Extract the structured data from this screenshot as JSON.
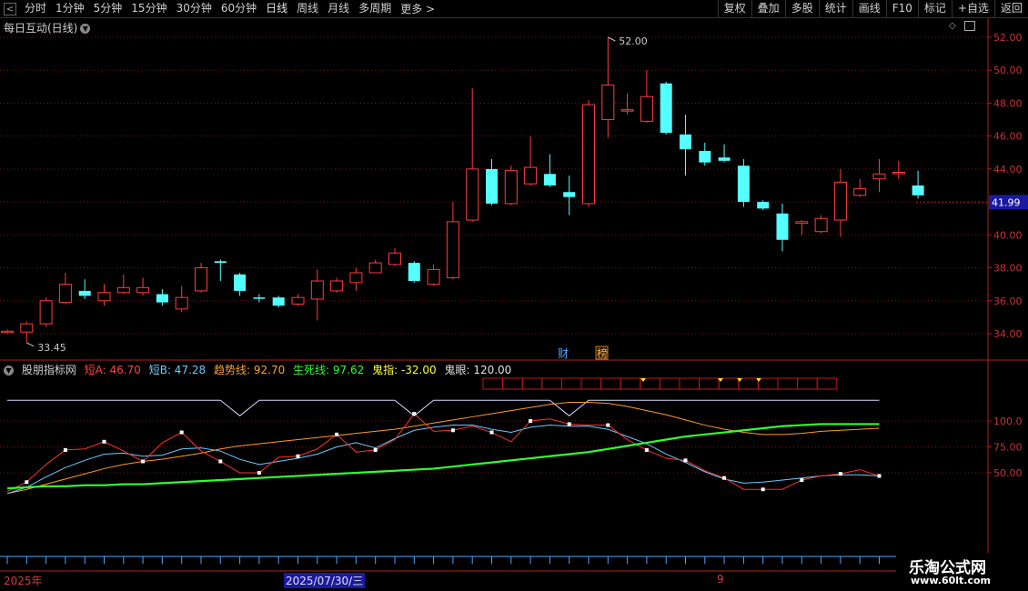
{
  "toolbar": {
    "periods": [
      "分时",
      "1分钟",
      "5分钟",
      "15分钟",
      "30分钟",
      "60分钟",
      "日线",
      "周线",
      "月线",
      "多周期"
    ],
    "more_label": "更多 >",
    "tools": [
      "复权",
      "叠加",
      "多股",
      "统计",
      "画线",
      "F10",
      "标记",
      "+自选",
      "返回"
    ]
  },
  "stock": {
    "title": "每日互动(日线)"
  },
  "price_axis": {
    "ticks": [
      "52.00",
      "50.00",
      "48.00",
      "46.00",
      "44.00",
      "42.00",
      "40.00",
      "38.00",
      "36.00",
      "34.00"
    ],
    "current": "41.99"
  },
  "annotations": {
    "high": "52.00",
    "low": "33.45",
    "fin_label": "财",
    "flag_label": "榜"
  },
  "indicator": {
    "name": "股朋指标网",
    "items": [
      {
        "label": "短A: 46.70",
        "color": "#ff4040"
      },
      {
        "label": "短B: 47.28",
        "color": "#6ec8ff"
      },
      {
        "label": "趋势线: 92.70",
        "color": "#ffa030"
      },
      {
        "label": "生死线: 97.62",
        "color": "#30ff30"
      },
      {
        "label": "鬼指: -32.00",
        "color": "#ffff40"
      },
      {
        "label": "鬼眼: 120.00",
        "color": "#e0e0e0"
      }
    ],
    "axis_ticks": [
      "100.0",
      "75.00",
      "50.00"
    ]
  },
  "dates": {
    "left": "2025年",
    "cursor": "2025/07/30/三",
    "mark": "9"
  },
  "watermark": {
    "title": "乐淘公式网",
    "url": "www.60lt.com"
  },
  "chart_data": {
    "type": "candlestick",
    "ylim": [
      33,
      53
    ],
    "candles": [
      [
        34.1,
        34.15,
        34.25,
        34.0
      ],
      [
        34.1,
        34.6,
        34.75,
        33.45
      ],
      [
        34.6,
        36.0,
        36.2,
        34.4
      ],
      [
        35.9,
        37.0,
        37.7,
        35.8
      ],
      [
        36.6,
        36.3,
        37.3,
        36.1
      ],
      [
        36.0,
        36.5,
        37.0,
        35.7
      ],
      [
        36.5,
        36.8,
        37.6,
        36.4
      ],
      [
        36.5,
        36.8,
        37.4,
        36.3
      ],
      [
        36.4,
        35.9,
        36.7,
        35.7
      ],
      [
        35.5,
        36.2,
        36.9,
        35.3
      ],
      [
        36.6,
        38.0,
        38.3,
        36.5
      ],
      [
        38.4,
        38.3,
        38.5,
        37.2
      ],
      [
        37.6,
        36.6,
        37.7,
        36.3
      ],
      [
        36.2,
        36.15,
        36.4,
        35.9
      ],
      [
        36.2,
        35.7,
        36.3,
        35.6
      ],
      [
        35.8,
        36.2,
        36.4,
        35.7
      ],
      [
        36.1,
        37.2,
        37.9,
        34.8
      ],
      [
        36.6,
        37.2,
        37.4,
        36.5
      ],
      [
        37.1,
        37.7,
        38.0,
        36.6
      ],
      [
        37.7,
        38.3,
        38.5,
        37.7
      ],
      [
        38.2,
        38.9,
        39.2,
        38.1
      ],
      [
        38.3,
        37.2,
        38.4,
        37.1
      ],
      [
        37.0,
        37.9,
        38.2,
        36.9
      ],
      [
        37.4,
        40.8,
        42.0,
        37.3
      ],
      [
        40.9,
        44.0,
        48.9,
        40.8
      ],
      [
        44.0,
        41.9,
        44.6,
        41.8
      ],
      [
        41.9,
        43.9,
        44.2,
        41.8
      ],
      [
        43.1,
        44.1,
        46.0,
        43.0
      ],
      [
        43.7,
        43.0,
        44.9,
        42.9
      ],
      [
        42.6,
        42.3,
        43.6,
        41.2
      ],
      [
        41.9,
        47.9,
        48.2,
        41.7
      ],
      [
        47.0,
        49.1,
        52.0,
        45.9
      ],
      [
        47.6,
        47.6,
        48.6,
        47.3
      ],
      [
        46.9,
        48.4,
        50.0,
        46.8
      ],
      [
        49.2,
        46.2,
        49.3,
        46.1
      ],
      [
        46.1,
        45.2,
        47.3,
        43.6
      ],
      [
        45.1,
        44.4,
        45.6,
        44.2
      ],
      [
        44.7,
        44.5,
        45.5,
        44.4
      ],
      [
        44.2,
        42.0,
        44.6,
        41.7
      ],
      [
        42.0,
        41.6,
        42.1,
        41.5
      ],
      [
        41.3,
        39.7,
        41.9,
        39.0
      ],
      [
        40.7,
        40.8,
        40.9,
        40.0
      ],
      [
        40.2,
        41.0,
        41.2,
        40.1
      ],
      [
        40.9,
        43.2,
        44.0,
        39.9
      ],
      [
        42.4,
        42.8,
        43.4,
        42.3
      ],
      [
        43.4,
        43.7,
        44.6,
        42.6
      ],
      [
        43.8,
        43.8,
        44.5,
        43.4
      ],
      [
        43.0,
        42.4,
        43.9,
        42.2
      ]
    ],
    "ind_ylim": [
      0,
      150
    ],
    "shortA": [
      32,
      41,
      58,
      72,
      73,
      80,
      71,
      61,
      79,
      89,
      71,
      61,
      50,
      50,
      65,
      66,
      73,
      87,
      70,
      72,
      82,
      107,
      90,
      91,
      95,
      89,
      80,
      100,
      102,
      97,
      96,
      96,
      82,
      72,
      64,
      62,
      52,
      45,
      34,
      34,
      34,
      43,
      47,
      49,
      53,
      47
    ],
    "shortB": [
      30,
      36,
      46,
      55,
      62,
      68,
      69,
      66,
      67,
      73,
      74,
      71,
      63,
      58,
      61,
      64,
      68,
      75,
      79,
      74,
      83,
      91,
      94,
      96,
      96,
      92,
      89,
      94,
      96,
      95,
      95,
      92,
      85,
      78,
      68,
      60,
      51,
      44,
      40,
      41,
      43,
      45,
      47,
      48,
      48,
      47
    ],
    "trend": [
      30,
      34,
      39,
      44,
      49,
      54,
      58,
      61,
      63,
      66,
      69,
      73,
      76,
      78,
      80,
      82,
      84,
      86,
      88,
      90,
      92,
      95,
      98,
      101,
      104,
      107,
      110,
      113,
      116,
      118,
      118,
      117,
      114,
      110,
      106,
      101,
      96,
      92,
      89,
      87,
      87,
      88,
      90,
      91,
      92,
      93
    ],
    "life": [
      35,
      36,
      37,
      37,
      38,
      38,
      39,
      39,
      40,
      41,
      42,
      43,
      44,
      45,
      46,
      47,
      48,
      49,
      50,
      51,
      52,
      53,
      54,
      56,
      58,
      60,
      62,
      64,
      66,
      68,
      70,
      73,
      76,
      79,
      82,
      85,
      87,
      89,
      91,
      93,
      95,
      96,
      97,
      97,
      97,
      97
    ],
    "ghost_eye": [
      120,
      120,
      120,
      120,
      120,
      120,
      120,
      120,
      120,
      120,
      120,
      120,
      105,
      120,
      120,
      120,
      120,
      120,
      120,
      120,
      120,
      105,
      120,
      120,
      120,
      120,
      120,
      120,
      120,
      105,
      120,
      120,
      120,
      120,
      120,
      120,
      120,
      120,
      120,
      120,
      120,
      120,
      120,
      120,
      120,
      120
    ]
  }
}
